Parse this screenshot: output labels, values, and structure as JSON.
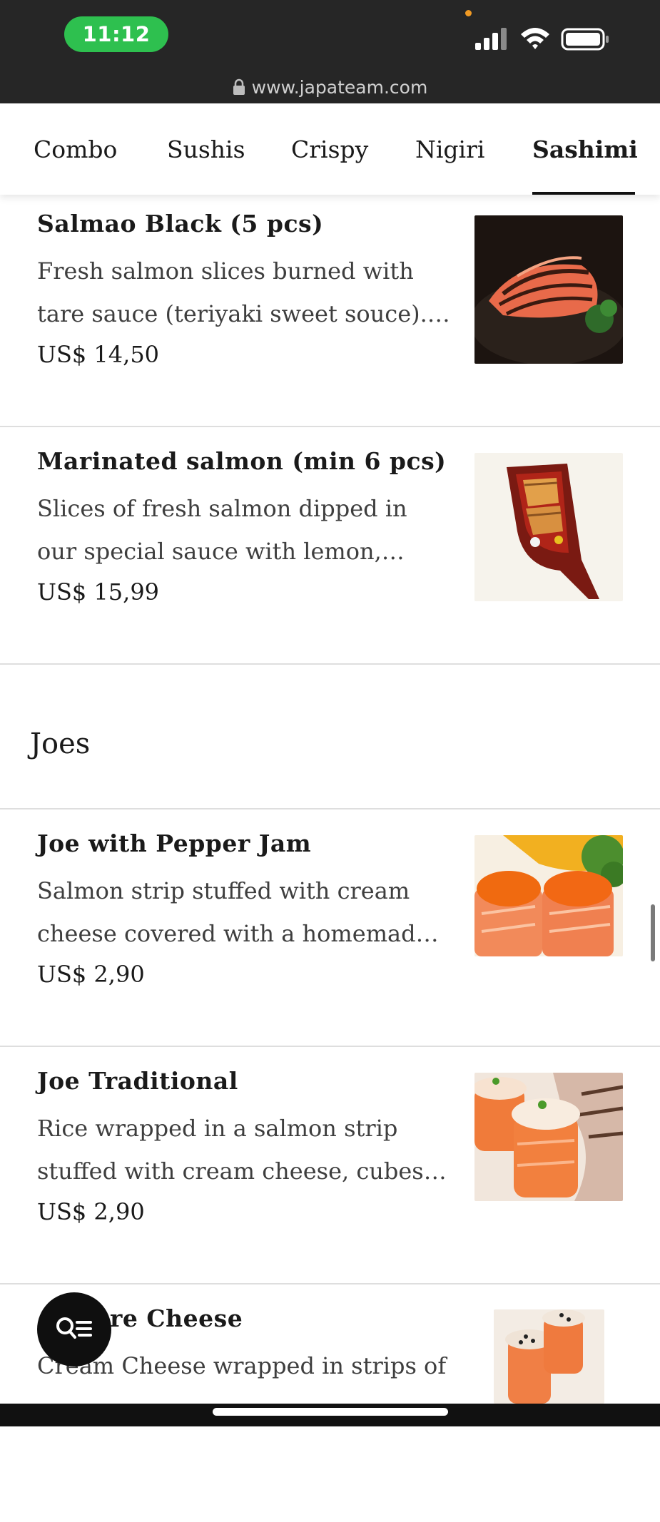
{
  "status_bar": {
    "time": "11:12",
    "url": "www.japateam.com",
    "icons": [
      "signal-icon",
      "wifi-icon",
      "battery-icon",
      "lock-icon"
    ]
  },
  "tabs": [
    {
      "label": "Combo",
      "active": false
    },
    {
      "label": "Sushis",
      "active": false
    },
    {
      "label": "Crispy",
      "active": false
    },
    {
      "label": "Nigiri",
      "active": false
    },
    {
      "label": "Sashimi",
      "active": true
    }
  ],
  "sashimi_items": [
    {
      "name": "Salmao Black (5 pcs)",
      "description": "Fresh salmon slices burned with tare sauce (teriyaki sweet souce). - Shoyu sauce",
      "price": "US$ 14,50"
    },
    {
      "name": "Marinated salmon (min 6 pcs)",
      "description": "Slices of fresh salmon dipped in our special sauce with lemon, shoyo and herbs",
      "price": "US$ 15,99"
    }
  ],
  "joes_section": {
    "title": "Joes",
    "items": [
      {
        "name": "Joe with Pepper Jam",
        "description": "Salmon strip stuffed with cream cheese covered with a homemade pepper jam",
        "price": "US$ 2,90"
      },
      {
        "name": "Joe Traditional",
        "description": "Rice wrapped in a salmon strip stuffed with cream cheese, cubes of salmon",
        "price": "US$ 2,90"
      },
      {
        "name": "re Cheese",
        "description": "Cream Cheese wrapped in strips of"
      }
    ]
  },
  "colors": {
    "status_bg": "#262626",
    "time_pill": "#2ec04f",
    "fab_bg": "#0f0f0f",
    "divider": "#dedede"
  }
}
